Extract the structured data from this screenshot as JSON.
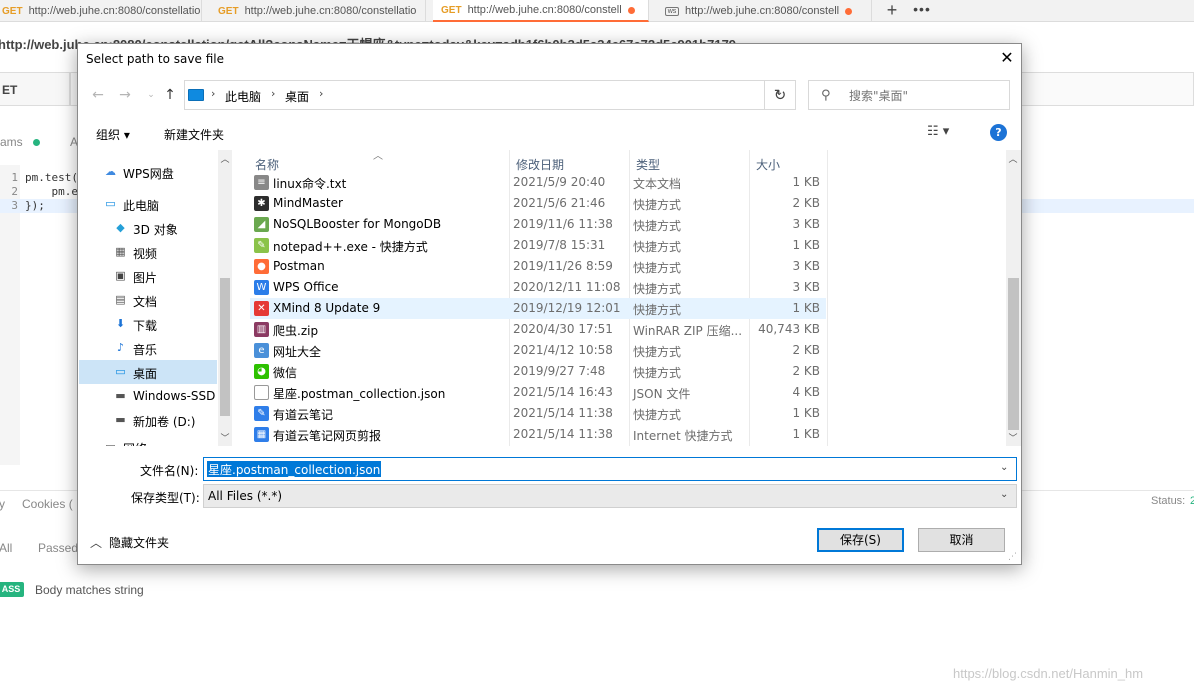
{
  "browser_tabs": [
    {
      "method": "GET",
      "url": "http://web.juhe.cn:8080/constellatio",
      "active": false,
      "dot": false
    },
    {
      "method": "GET",
      "url": "http://web.juhe.cn:8080/constellatio",
      "active": false,
      "dot": false
    },
    {
      "method": "GET",
      "url": "http://web.juhe.cn:8080/constell",
      "active": true,
      "dot": true
    },
    {
      "method": "",
      "url": "http://web.juhe.cn:8080/constell",
      "active": false,
      "dot": true
    }
  ],
  "request": {
    "title": "http://web.juhe.cn:8080/constellation/getAll?consName=天蝎座&type=today&key=adb1f6b0b3d5a34e67c72d5c901b7179",
    "method": "ET",
    "tab_params": "rams",
    "tab_auth": "A"
  },
  "code": [
    {
      "n": "1",
      "text": "pm.test("
    },
    {
      "n": "2",
      "text": "    pm.e"
    },
    {
      "n": "3",
      "text": "});"
    }
  ],
  "response": {
    "tab_body": "y",
    "tab_cookies": "Cookies (",
    "status_label": "Status:",
    "status_value": "2",
    "filter_all": "All",
    "filter_passed": "Passed",
    "test_badge": "ASS",
    "test_name": "Body matches string"
  },
  "watermark": "https://blog.csdn.net/Hanmin_hm",
  "dialog": {
    "title": "Select path to save file",
    "close_glyph": "✕",
    "address": [
      "此电脑",
      "桌面"
    ],
    "search_placeholder": "搜索\"桌面\"",
    "toolbar": {
      "organize": "组织 ▾",
      "new_folder": "新建文件夹",
      "view": "☷ ▾",
      "help": "?"
    },
    "nav_items": [
      {
        "label": "WPS网盘",
        "icon": "cloud-icon",
        "glyph": "☁",
        "color": "#3f8ae0",
        "selected": false
      },
      {
        "label": "此电脑",
        "icon": "computer-icon",
        "glyph": "▭",
        "color": "#0f8ae0",
        "selected": false
      },
      {
        "label": "3D 对象",
        "icon": "cube-icon",
        "glyph": "◆",
        "color": "#25a0d8",
        "selected": false
      },
      {
        "label": "视频",
        "icon": "video-icon",
        "glyph": "▦",
        "color": "#555555",
        "selected": false
      },
      {
        "label": "图片",
        "icon": "picture-icon",
        "glyph": "▣",
        "color": "#444444",
        "selected": false
      },
      {
        "label": "文档",
        "icon": "document-icon",
        "glyph": "▤",
        "color": "#555555",
        "selected": false
      },
      {
        "label": "下载",
        "icon": "download-icon",
        "glyph": "⬇",
        "color": "#1c73d6",
        "selected": false
      },
      {
        "label": "音乐",
        "icon": "music-icon",
        "glyph": "♪",
        "color": "#1c73d6",
        "selected": false
      },
      {
        "label": "桌面",
        "icon": "desktop-icon",
        "glyph": "▭",
        "color": "#0f8ae0",
        "selected": true
      },
      {
        "label": "Windows-SSD",
        "icon": "drive-icon",
        "glyph": "▬",
        "color": "#555555",
        "selected": false
      },
      {
        "label": "新加卷 (D:)",
        "icon": "drive-icon",
        "glyph": "▬",
        "color": "#555555",
        "selected": false
      },
      {
        "label": "网络",
        "icon": "network-icon",
        "glyph": "▭",
        "color": "#555555",
        "selected": false
      }
    ],
    "columns": {
      "name": "名称",
      "date": "修改日期",
      "type": "类型",
      "size": "大小"
    },
    "files": [
      {
        "name": "linux命令.txt",
        "date": "2021/5/9 20:40",
        "type": "文本文档",
        "size": "1 KB",
        "icon": "text-file-icon",
        "glyph": "≡",
        "color": "#888888"
      },
      {
        "name": "MindMaster",
        "date": "2021/5/6 21:46",
        "type": "快捷方式",
        "size": "2 KB",
        "icon": "mindmaster-icon",
        "glyph": "✱",
        "color": "#2d2d2d"
      },
      {
        "name": "NoSQLBooster for MongoDB",
        "date": "2019/11/6 11:38",
        "type": "快捷方式",
        "size": "3 KB",
        "icon": "nosqlbooster-icon",
        "glyph": "◢",
        "color": "#6aa84f"
      },
      {
        "name": "notepad++.exe - 快捷方式",
        "date": "2019/7/8 15:31",
        "type": "快捷方式",
        "size": "1 KB",
        "icon": "notepadpp-icon",
        "glyph": "✎",
        "color": "#8bc34a"
      },
      {
        "name": "Postman",
        "date": "2019/11/26 8:59",
        "type": "快捷方式",
        "size": "3 KB",
        "icon": "postman-icon",
        "glyph": "●",
        "color": "#ff6c37"
      },
      {
        "name": "WPS Office",
        "date": "2020/12/11 11:08",
        "type": "快捷方式",
        "size": "3 KB",
        "icon": "wps-icon",
        "glyph": "W",
        "color": "#2b7de9"
      },
      {
        "name": "XMind 8 Update 9",
        "date": "2019/12/19 12:01",
        "type": "快捷方式",
        "size": "1 KB",
        "icon": "xmind-icon",
        "glyph": "✕",
        "color": "#e53935",
        "highlight": true
      },
      {
        "name": "爬虫.zip",
        "date": "2020/4/30 17:51",
        "type": "WinRAR ZIP 压缩...",
        "size": "40,743 KB",
        "icon": "zip-archive-icon",
        "glyph": "▥",
        "color": "#8b3a62"
      },
      {
        "name": "网址大全",
        "date": "2021/4/12 10:58",
        "type": "快捷方式",
        "size": "2 KB",
        "icon": "browser-icon",
        "glyph": "e",
        "color": "#4a90d9"
      },
      {
        "name": "微信",
        "date": "2019/9/27 7:48",
        "type": "快捷方式",
        "size": "2 KB",
        "icon": "wechat-icon",
        "glyph": "◕",
        "color": "#2dc100"
      },
      {
        "name": "星座.postman_collection.json",
        "date": "2021/5/14 16:43",
        "type": "JSON 文件",
        "size": "4 KB",
        "icon": "json-file-icon",
        "glyph": " ",
        "color": "#ffffff"
      },
      {
        "name": "有道云笔记",
        "date": "2021/5/14 11:38",
        "type": "快捷方式",
        "size": "1 KB",
        "icon": "youdao-note-icon",
        "glyph": "✎",
        "color": "#2f7ee9"
      },
      {
        "name": "有道云笔记网页剪报",
        "date": "2021/5/14 11:38",
        "type": "Internet 快捷方式",
        "size": "1 KB",
        "icon": "web-clip-icon",
        "glyph": "▦",
        "color": "#2f7ee9"
      }
    ],
    "filename_label": "文件名(N):",
    "filename_value": "星座.postman_collection.json",
    "type_label": "保存类型(T):",
    "type_value": "All Files (*.*)",
    "hide_folders": "隐藏文件夹",
    "save_label": "保存(S)",
    "cancel_label": "取消"
  }
}
